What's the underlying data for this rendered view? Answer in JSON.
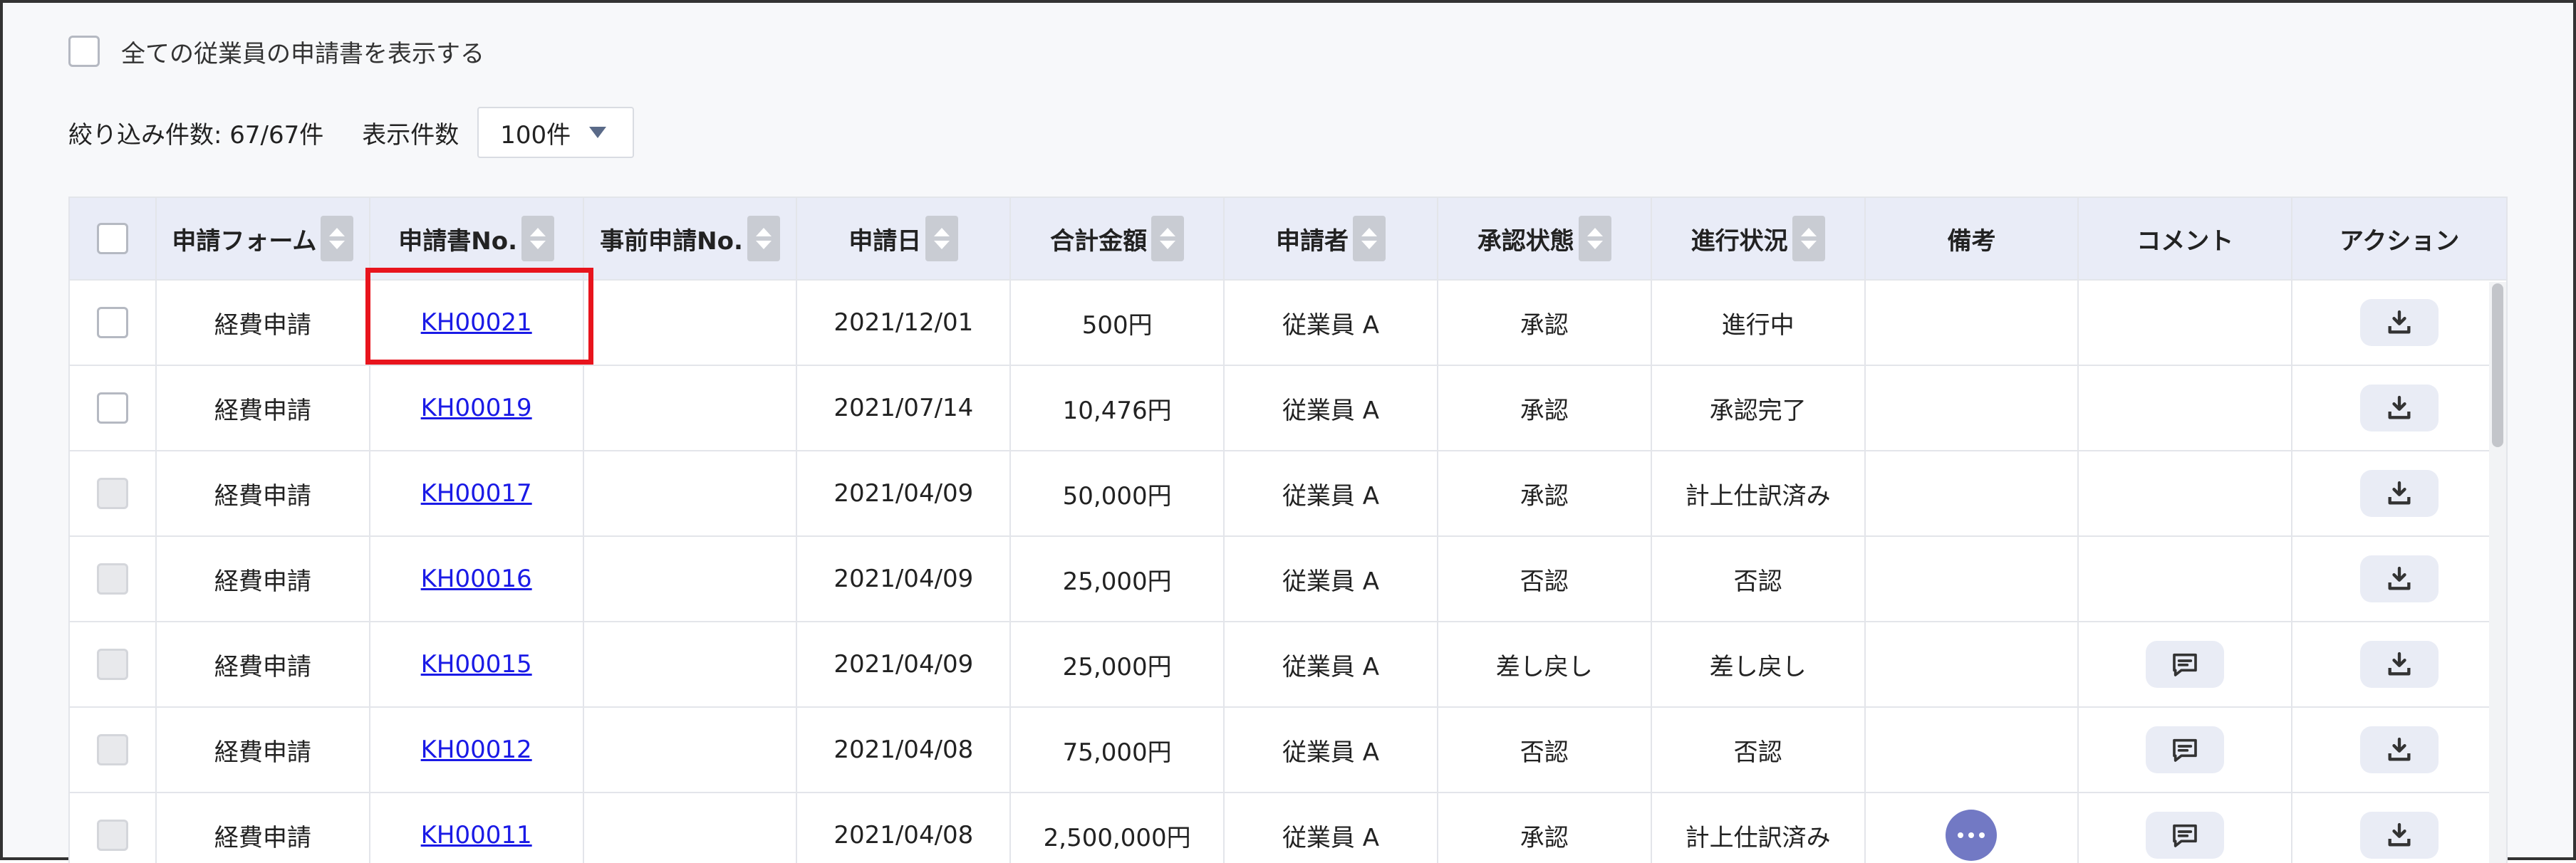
{
  "show_all": {
    "label": "全ての従業員の申請書を表示する",
    "checked": false
  },
  "filter": {
    "count_text": "絞り込み件数: 67/67件",
    "per_page_label": "表示件数",
    "per_page_value": "100件"
  },
  "table": {
    "headers": [
      {
        "label": "申請フォーム",
        "sortable": true
      },
      {
        "label": "申請書No.",
        "sortable": true
      },
      {
        "label": "事前申請No.",
        "sortable": true
      },
      {
        "label": "申請日",
        "sortable": true
      },
      {
        "label": "合計金額",
        "sortable": true
      },
      {
        "label": "申請者",
        "sortable": true
      },
      {
        "label": "承認状態",
        "sortable": true
      },
      {
        "label": "進行状況",
        "sortable": true
      },
      {
        "label": "備考",
        "sortable": false
      },
      {
        "label": "コメント",
        "sortable": false
      },
      {
        "label": "アクション",
        "sortable": false
      }
    ],
    "rows": [
      {
        "checkbox": "enabled",
        "form": "経費申請",
        "doc_no": "KH00021",
        "pre_no": "",
        "date": "2021/12/01",
        "amount": "500円",
        "applicant": "従業員 A",
        "approval": "承認",
        "progress": "進行中",
        "note_icon": false,
        "comment_icon": false
      },
      {
        "checkbox": "enabled",
        "form": "経費申請",
        "doc_no": "KH00019",
        "pre_no": "",
        "date": "2021/07/14",
        "amount": "10,476円",
        "applicant": "従業員 A",
        "approval": "承認",
        "progress": "承認完了",
        "note_icon": false,
        "comment_icon": false
      },
      {
        "checkbox": "disabled",
        "form": "経費申請",
        "doc_no": "KH00017",
        "pre_no": "",
        "date": "2021/04/09",
        "amount": "50,000円",
        "applicant": "従業員 A",
        "approval": "承認",
        "progress": "計上仕訳済み",
        "note_icon": false,
        "comment_icon": false
      },
      {
        "checkbox": "disabled",
        "form": "経費申請",
        "doc_no": "KH00016",
        "pre_no": "",
        "date": "2021/04/09",
        "amount": "25,000円",
        "applicant": "従業員 A",
        "approval": "否認",
        "progress": "否認",
        "note_icon": false,
        "comment_icon": false
      },
      {
        "checkbox": "disabled",
        "form": "経費申請",
        "doc_no": "KH00015",
        "pre_no": "",
        "date": "2021/04/09",
        "amount": "25,000円",
        "applicant": "従業員 A",
        "approval": "差し戻し",
        "progress": "差し戻し",
        "note_icon": false,
        "comment_icon": true
      },
      {
        "checkbox": "disabled",
        "form": "経費申請",
        "doc_no": "KH00012",
        "pre_no": "",
        "date": "2021/04/08",
        "amount": "75,000円",
        "applicant": "従業員 A",
        "approval": "否認",
        "progress": "否認",
        "note_icon": false,
        "comment_icon": true
      },
      {
        "checkbox": "disabled",
        "form": "経費申請",
        "doc_no": "KH00011",
        "pre_no": "",
        "date": "2021/04/08",
        "amount": "2,500,000円",
        "applicant": "従業員 A",
        "approval": "承認",
        "progress": "計上仕訳済み",
        "note_icon": true,
        "comment_icon": true
      }
    ],
    "icons": {
      "download": "download-icon",
      "comment": "comment-icon",
      "note": "more-icon"
    },
    "colors": {
      "link": "#1a1ae6",
      "header_bg": "#e9ecf7",
      "highlight": "#e8141d",
      "note_button": "#7279c4"
    }
  }
}
